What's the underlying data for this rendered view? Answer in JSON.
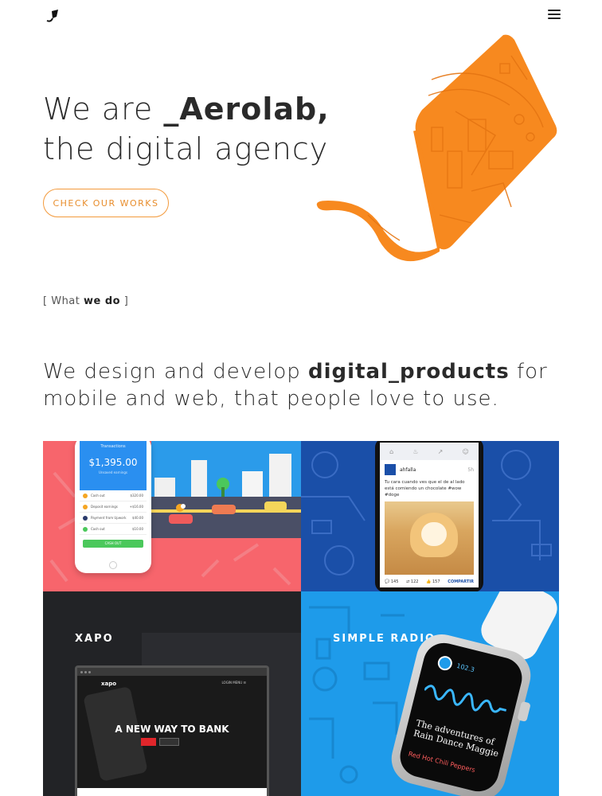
{
  "header": {
    "logo_icon": "kite-logo-icon",
    "menu_icon": "hamburger-menu-icon"
  },
  "hero": {
    "line1_prefix": "We are ",
    "line1_brand": "_Aerolab,",
    "line2": "the digital agency",
    "cta_label": "CHECK OUR WORKS",
    "illustration": "orange-kite-city-illustration",
    "accent_color": "#f7891f"
  },
  "section": {
    "tag_open": "[ ",
    "tag_what": "What ",
    "tag_we_do": "we do",
    "tag_close": " ]",
    "intro_prefix": "We design and develop ",
    "intro_bold": "digital_products",
    "intro_suffix_line1": " for",
    "intro_line2": "mobile and web, that people love to use."
  },
  "projects": [
    {
      "name": "",
      "screen_title": "Transactions",
      "balance": "$1,395.00",
      "balance_caption": "Unsaved earnings",
      "rows": [
        {
          "label": "Cash out",
          "amount": "$320.00",
          "color": "#f5a623"
        },
        {
          "label": "Deposit earnings",
          "amount": "+$16.00",
          "color": "#f5a623"
        },
        {
          "label": "Payment from Upwork",
          "amount": "$40.00",
          "color": "#2a3a6b"
        },
        {
          "label": "Cash out",
          "amount": "$10.00",
          "color": "#4bc85b"
        }
      ],
      "button": "CASH OUT"
    },
    {
      "name": "",
      "user": "ahfalla",
      "time": "5h",
      "post_text": "Tu cara cuando ves que el de al lado está comiendo un chocolate #wow #doge",
      "comments": "145",
      "reposts": "122",
      "likes": "157",
      "share": "COMPARTIR"
    },
    {
      "name": "XAPO",
      "logo": "xapo",
      "nav": "LOGIN    MENU ☰",
      "headline": "A NEW WAY TO BANK",
      "btn_primary": "",
      "btn_secondary": ""
    },
    {
      "name": "SIMPLE RADIO",
      "frequency": "102.3",
      "song": "The adventures of Rain Dance Maggie",
      "artist": "Red Hot Chili Peppers"
    }
  ]
}
